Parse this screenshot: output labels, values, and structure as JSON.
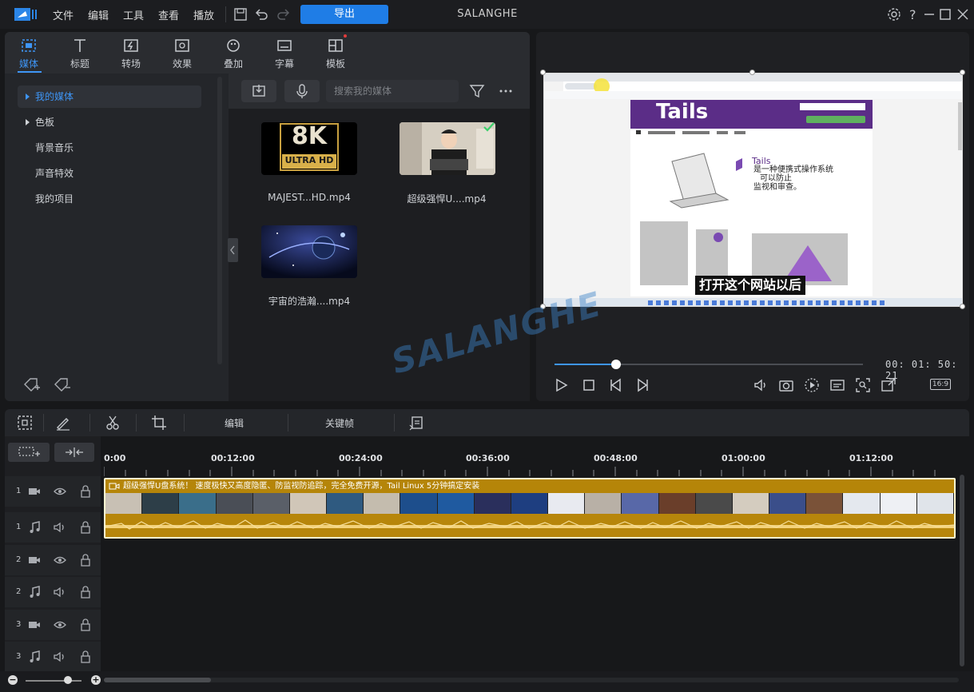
{
  "titlebar": {
    "menu": [
      "文件",
      "编辑",
      "工具",
      "查看",
      "播放"
    ],
    "export_label": "导出",
    "app_title": "SALANGHE"
  },
  "tabs": [
    {
      "label": "媒体",
      "icon": "media-icon",
      "active": true
    },
    {
      "label": "标题",
      "icon": "title-icon"
    },
    {
      "label": "转场",
      "icon": "transition-icon"
    },
    {
      "label": "效果",
      "icon": "effect-icon"
    },
    {
      "label": "叠加",
      "icon": "overlay-icon"
    },
    {
      "label": "字幕",
      "icon": "subtitle-icon"
    },
    {
      "label": "模板",
      "icon": "template-icon"
    }
  ],
  "sidebar": {
    "items": [
      {
        "label": "我的媒体",
        "expandable": true,
        "active": true
      },
      {
        "label": "色板",
        "expandable": true
      },
      {
        "label": "背景音乐"
      },
      {
        "label": "声音特效"
      },
      {
        "label": "我的项目"
      }
    ]
  },
  "media": {
    "search_placeholder": "搜索我的媒体",
    "items": [
      {
        "label": "MAJEST...HD.mp4",
        "thumb_text_big": "8K",
        "thumb_text_small": "ULTRA HD"
      },
      {
        "label": "超级强悍U....mp4",
        "checked": true
      },
      {
        "label": "宇宙的浩瀚....mp4"
      }
    ]
  },
  "preview": {
    "subtitle": "打开这个网站以后",
    "site_logo": "Tails",
    "site_lines": [
      "Tails",
      "是一种便携式操作系统",
      "可以防止",
      "监视和审查。"
    ],
    "timecode": "00: 01: 50: 21",
    "progress": 0.2,
    "aspect": "16:9"
  },
  "timeline": {
    "toolbar": {
      "edit_label": "编辑",
      "keyframe_label": "关键帧"
    },
    "ruler": [
      "0:00",
      "00:12:00",
      "00:24:00",
      "00:36:00",
      "00:48:00",
      "01:00:00",
      "01:12:00"
    ],
    "tracks": [
      {
        "num": "1",
        "type": "video"
      },
      {
        "num": "1",
        "type": "audio"
      },
      {
        "num": "2",
        "type": "video"
      },
      {
        "num": "2",
        "type": "audio"
      },
      {
        "num": "3",
        "type": "video"
      },
      {
        "num": "3",
        "type": "audio"
      }
    ],
    "clip_title": "超级强悍U盘系统！ 速度极快又高度隐匿、防监视防追踪，完全免费开源，Tail Linux 5分钟搞定安装"
  },
  "watermark": "SALANGHE"
}
